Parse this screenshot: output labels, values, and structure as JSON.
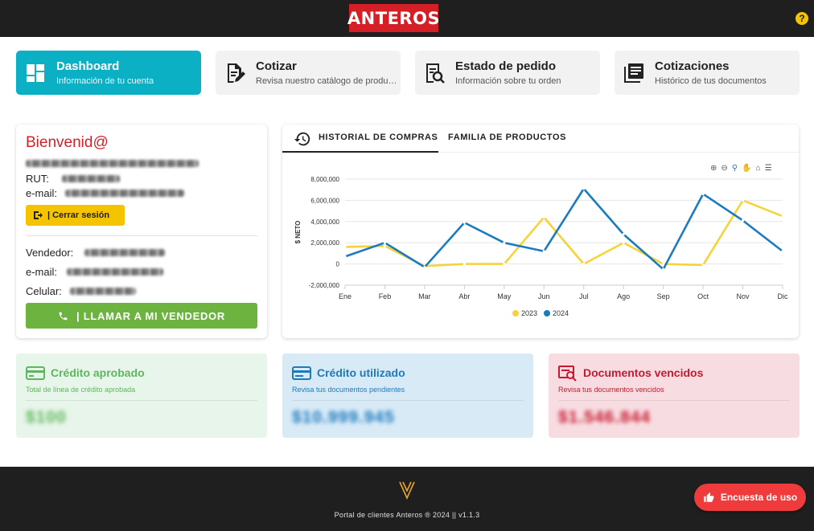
{
  "header": {
    "logo_text": "ANTEROS",
    "help_label": "?"
  },
  "nav": [
    {
      "title": "Dashboard",
      "subtitle": "Información de tu cuenta",
      "icon": "dashboard-icon"
    },
    {
      "title": "Cotizar",
      "subtitle": "Revisa nuestro catálogo de productos",
      "icon": "quote-edit-icon"
    },
    {
      "title": "Estado de pedido",
      "subtitle": "Información sobre tu orden",
      "icon": "order-search-icon"
    },
    {
      "title": "Cotizaciones",
      "subtitle": "Histórico de tus documentos",
      "icon": "documents-icon"
    }
  ],
  "welcome": {
    "title": "Bienvenid@",
    "rut_label": "RUT:",
    "email_label": "e-mail:",
    "logout_label": "| Cerrar sesión",
    "seller_label": "Vendedor:",
    "seller_email_label": "e-mail:",
    "phone_label": "Celular:",
    "call_label": "| LLAMAR A MI VENDEDOR"
  },
  "chart_tabs": {
    "active": "HISTORIAL DE COMPRAS",
    "other": "FAMILIA DE PRODUCTOS"
  },
  "chart_data": {
    "type": "line",
    "ylabel": "$ NETO",
    "xlabel": "",
    "categories": [
      "Ene",
      "Feb",
      "Mar",
      "Abr",
      "May",
      "Jun",
      "Jul",
      "Ago",
      "Sep",
      "Nov",
      "Dic"
    ],
    "x_all": [
      "Ene",
      "Feb",
      "Mar",
      "Abr",
      "May",
      "Jun",
      "Jul",
      "Ago",
      "Sep",
      "Oct",
      "Nov",
      "Dic"
    ],
    "yticks": [
      "8,000,000",
      "6,000,000",
      "4,000,000",
      "2,000,000",
      "0",
      "-2,000,000"
    ],
    "ylim": [
      -2000000,
      8000000
    ],
    "grid": true,
    "legend": "bottom",
    "series": [
      {
        "name": "2023",
        "color": "#f7d33a",
        "values": [
          1600000,
          1700000,
          -200000,
          0,
          0,
          4400000,
          0,
          2000000,
          0,
          -100000,
          6000000,
          4500000
        ]
      },
      {
        "name": "2024",
        "color": "#1a7bbf",
        "values": [
          700000,
          2000000,
          -300000,
          3900000,
          2000000,
          1200000,
          7100000,
          2800000,
          -500000,
          6600000,
          4100000,
          1200000
        ]
      }
    ]
  },
  "stats": [
    {
      "title": "Crédito aprobado",
      "subtitle": "Total de línea de crédito aprobada",
      "value": "$100",
      "color": "#5cb85c",
      "bg": "#e8f5ea"
    },
    {
      "title": "Crédito utilizado",
      "subtitle": "Revisa tus documentos pendientes",
      "value": "$10.999.945",
      "color": "#1a7bbf",
      "bg": "#d9eaf7"
    },
    {
      "title": "Documentos vencidos",
      "subtitle": "Revisa tus documentos vencidos",
      "value": "$1.546.844",
      "color": "#c9182f",
      "bg": "#f7dde1"
    }
  ],
  "footer": {
    "text": "Portal de clientes Anteros ® 2024 || v1.1.3"
  },
  "survey": {
    "label": "Encuesta de uso"
  }
}
